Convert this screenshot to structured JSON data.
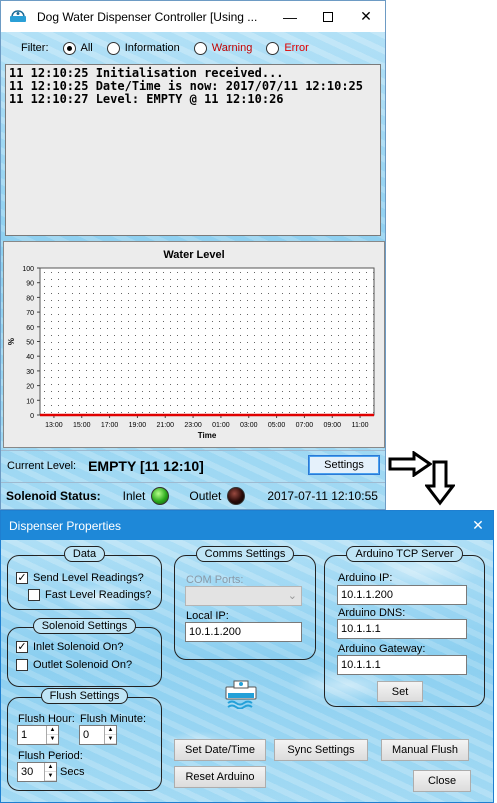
{
  "main_window": {
    "title": "Dog Water Dispenser Controller [Using ...",
    "filter": {
      "label": "Filter:",
      "options": [
        "All",
        "Information",
        "Warning",
        "Error"
      ],
      "selected": "All",
      "colors": {
        "Warning": "#c00000",
        "Error": "#e00000"
      }
    },
    "log_lines": [
      "11 12:10:25 Initialisation received...",
      "11 12:10:25 Date/Time is now: 2017/07/11 12:10:25",
      "11 12:10:27 Level: EMPTY @ 11 12:10:26"
    ],
    "chart_title": "Water Level",
    "current_level_label": "Current Level:",
    "current_level_value": "EMPTY [11 12:10]",
    "settings_button": "Settings",
    "solenoid_status_label": "Solenoid Status:",
    "inlet_label": "Inlet",
    "outlet_label": "Outlet",
    "timestamp": "2017-07-11 12:10:55"
  },
  "chart_data": {
    "type": "line",
    "title": "Water Level",
    "xlabel": "Time",
    "ylabel": "%",
    "x_ticks": [
      "13:00",
      "15:00",
      "17:00",
      "19:00",
      "21:00",
      "23:00",
      "01:00",
      "03:00",
      "05:00",
      "07:00",
      "09:00",
      "11:00"
    ],
    "y_ticks": [
      0,
      10,
      20,
      30,
      40,
      50,
      60,
      70,
      80,
      90,
      100
    ],
    "ylim": [
      0,
      100
    ],
    "series": [
      {
        "x": [
          "13:00",
          "11:00"
        ],
        "values": [
          0,
          0
        ],
        "color": "#e00000"
      }
    ],
    "grid": "dotted"
  },
  "dialog": {
    "title": "Dispenser Properties",
    "data_group": {
      "title": "Data",
      "send_level_readings": {
        "label": "Send Level Readings?",
        "checked": true
      },
      "fast_level_readings": {
        "label": "Fast Level Readings?",
        "checked": false
      }
    },
    "solenoid_group": {
      "title": "Solenoid Settings",
      "inlet": {
        "label": "Inlet Solenoid On?",
        "checked": true
      },
      "outlet": {
        "label": "Outlet Solenoid On?",
        "checked": false
      }
    },
    "flush_group": {
      "title": "Flush Settings",
      "hour_label": "Flush Hour:",
      "hour_value": "1",
      "minute_label": "Flush Minute:",
      "minute_value": "0",
      "period_label": "Flush Period:",
      "period_value": "30",
      "period_unit": "Secs"
    },
    "comms_group": {
      "title": "Comms Settings",
      "com_ports_label": "COM Ports:",
      "com_ports_value": "",
      "local_ip_label": "Local IP:",
      "local_ip_value": "10.1.1.200"
    },
    "arduino_group": {
      "title": "Arduino TCP Server",
      "ip_label": "Arduino IP:",
      "ip_value": "10.1.1.200",
      "dns_label": "Arduino DNS:",
      "dns_value": "10.1.1.1",
      "gateway_label": "Arduino Gateway:",
      "gateway_value": "10.1.1.1",
      "set_button": "Set"
    },
    "buttons": {
      "set_date_time": "Set Date/Time",
      "sync_settings": "Sync Settings",
      "manual_flush": "Manual Flush",
      "reset_arduino": "Reset Arduino",
      "close": "Close"
    }
  }
}
